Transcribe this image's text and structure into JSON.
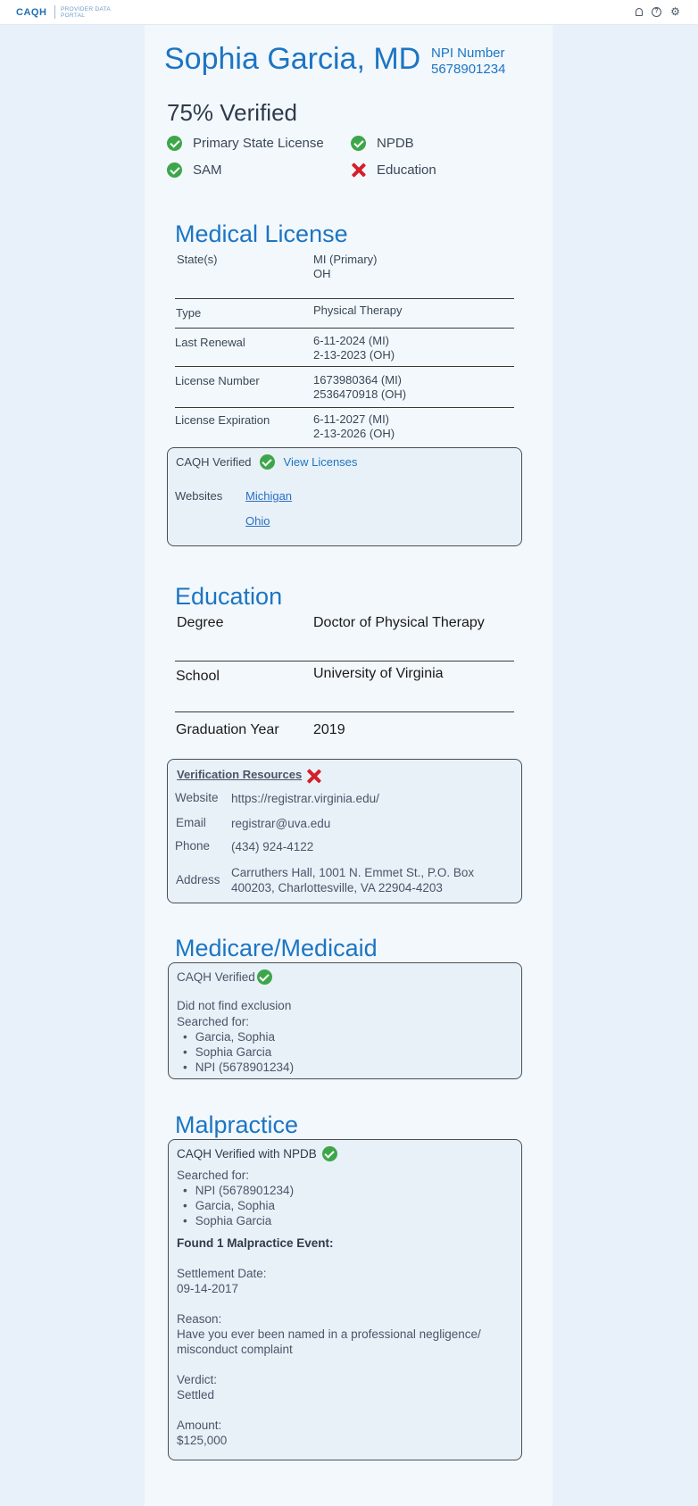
{
  "app": {
    "logo": "CAQH",
    "logo_sub": "PROVIDER DATA PORTAL"
  },
  "header": {
    "name": "Sophia Garcia, MD",
    "npi_label": "NPI Number",
    "npi_value": "5678901234"
  },
  "verification": {
    "percent_label": "75% Verified",
    "items": [
      {
        "label": "Primary State License",
        "status": "verified"
      },
      {
        "label": "NPDB",
        "status": "verified"
      },
      {
        "label": "SAM",
        "status": "verified"
      },
      {
        "label": "Education",
        "status": "failed"
      }
    ]
  },
  "medical_license": {
    "title": "Medical License",
    "rows": [
      {
        "label": "State(s)",
        "value_1": "MI (Primary)",
        "value_2": "OH"
      },
      {
        "label": "Type",
        "value_1": "Physical Therapy",
        "value_2": ""
      },
      {
        "label": "Last Renewal",
        "value_1": "6-11-2024 (MI)",
        "value_2": "2-13-2023 (OH)"
      },
      {
        "label": "License Number",
        "value_1": "1673980364 (MI)",
        "value_2": "2536470918 (OH)"
      },
      {
        "label": "License Expiration",
        "value_1": "6-11-2027 (MI)",
        "value_2": "2-13-2026 (OH)"
      }
    ],
    "box": {
      "verified_label": "CAQH Verified",
      "view_link": "View Licenses",
      "websites_label": "Websites",
      "websites": [
        "Michigan",
        "Ohio"
      ]
    }
  },
  "education": {
    "title": "Education",
    "degree_label": "Degree",
    "degree_value": "Doctor of Physical Therapy",
    "school_label": "School",
    "school_value": "University of Virginia",
    "grad_label": "Graduation Year",
    "grad_value": "2019",
    "resources": {
      "title": "Verification Resources",
      "website_label": "Website",
      "website_value": "https://registrar.virginia.edu/",
      "email_label": "Email",
      "email_value": "registrar@uva.edu",
      "phone_label": "Phone",
      "phone_value": "(434) 924-4122",
      "address_label": "Address",
      "address_line1": "Carruthers Hall, 1001 N. Emmet St., P.O. Box",
      "address_line2": "400203, Charlottesville, VA 22904-4203"
    }
  },
  "medicare": {
    "title": "Medicare/Medicaid",
    "verified_label": "CAQH Verified",
    "result": "Did not find exclusion",
    "searched_label": "Searched for:",
    "searched": [
      "Garcia, Sophia",
      "Sophia Garcia",
      "NPI (5678901234)"
    ]
  },
  "malpractice": {
    "title": "Malpractice",
    "verified_label": "CAQH Verified with NPDB",
    "searched_label": "Searched for:",
    "searched": [
      "NPI (5678901234)",
      "Garcia, Sophia",
      "Sophia Garcia"
    ],
    "found_label": "Found 1 Malpractice Event:",
    "settlement_label": "Settlement Date:",
    "settlement_value": "09-14-2017",
    "reason_label": "Reason:",
    "reason_line1": "Have you ever been named in a professional negligence/",
    "reason_line2": "misconduct complaint",
    "verdict_label": "Verdict:",
    "verdict_value": "Settled",
    "amount_label": "Amount:",
    "amount_value": "$125,000"
  }
}
